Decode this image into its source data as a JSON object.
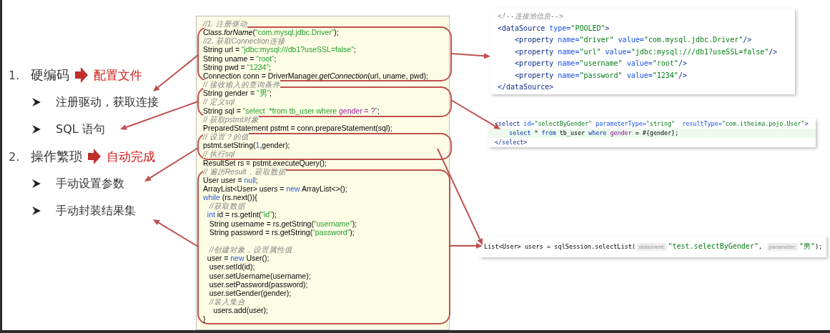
{
  "outline": [
    {
      "number": "1.",
      "text": "硬编码",
      "result": "配置文件",
      "children": [
        {
          "text": "注册驱动，获取连接"
        },
        {
          "text": "SQL 语句"
        }
      ]
    },
    {
      "number": "2.",
      "text": "操作繁琐",
      "result": "自动完成",
      "children": [
        {
          "text": "手动设置参数"
        },
        {
          "text": "手动封装结果集"
        }
      ]
    }
  ],
  "java_code": {
    "lines": [
      {
        "segments": [
          {
            "text": "//1. 注册驱动",
            "kind": "comment"
          }
        ]
      },
      {
        "segments": [
          {
            "text": "Class.",
            "kind": "plain"
          },
          {
            "text": "forName",
            "kind": "method"
          },
          {
            "text": "(",
            "kind": "plain"
          },
          {
            "text": "“com.mysql.jdbc.Driver”",
            "kind": "string"
          },
          {
            "text": ");",
            "kind": "plain"
          }
        ]
      },
      {
        "segments": [
          {
            "text": "//2. 获取Connection连接",
            "kind": "comment"
          }
        ]
      },
      {
        "segments": [
          {
            "text": "String url = ",
            "kind": "plain"
          },
          {
            "text": "“jdbc:mysql:///db1?useSSL=false”",
            "kind": "string"
          },
          {
            "text": ";",
            "kind": "plain"
          }
        ]
      },
      {
        "segments": [
          {
            "text": "String uname = ",
            "kind": "plain"
          },
          {
            "text": "“root”",
            "kind": "string"
          },
          {
            "text": ";",
            "kind": "plain"
          }
        ]
      },
      {
        "segments": [
          {
            "text": "String pwd = ",
            "kind": "plain"
          },
          {
            "text": "“1234”",
            "kind": "string"
          },
          {
            "text": ";",
            "kind": "plain"
          }
        ]
      },
      {
        "segments": [
          {
            "text": "Connection conn = DriverManager.",
            "kind": "plain"
          },
          {
            "text": "getConnection",
            "kind": "method"
          },
          {
            "text": "(url, uname, pwd);",
            "kind": "plain"
          }
        ]
      },
      {
        "segments": [
          {
            "text": "// 接收输入的查询条件",
            "kind": "comment"
          }
        ]
      },
      {
        "segments": [
          {
            "text": "String gender = ",
            "kind": "plain"
          },
          {
            "text": "“男”",
            "kind": "string"
          },
          {
            "text": ";",
            "kind": "plain"
          }
        ]
      },
      {
        "segments": [
          {
            "text": "// 定义sql",
            "kind": "comment"
          }
        ]
      },
      {
        "segments": [
          {
            "text": "String sql = ",
            "kind": "plain"
          },
          {
            "text": "“select  *from tb_user where ",
            "kind": "string"
          },
          {
            "text": "gender = ?",
            "kind": "field"
          },
          {
            "text": "”",
            "kind": "string"
          },
          {
            "text": ";",
            "kind": "plain"
          }
        ]
      },
      {
        "segments": [
          {
            "text": "// 获取pstmt对象",
            "kind": "comment"
          }
        ]
      },
      {
        "segments": [
          {
            "text": "PreparedStatement pstmt = conn.prepareStatement(sql);",
            "kind": "plain"
          }
        ]
      },
      {
        "segments": [
          {
            "text": "// 设置？的值",
            "kind": "comment"
          }
        ]
      },
      {
        "segments": [
          {
            "text": "pstmt.setString(",
            "kind": "plain"
          },
          {
            "text": "1",
            "kind": "number"
          },
          {
            "text": ",gender);",
            "kind": "plain"
          }
        ]
      },
      {
        "segments": [
          {
            "text": "// 执行sql",
            "kind": "comment"
          }
        ]
      },
      {
        "segments": [
          {
            "text": "ResultSet rs = pstmt.executeQuery();",
            "kind": "plain"
          }
        ]
      },
      {
        "segments": [
          {
            "text": "// 遍历Result，获取数据",
            "kind": "comment"
          }
        ]
      },
      {
        "segments": [
          {
            "text": "User user = ",
            "kind": "plain"
          },
          {
            "text": "null",
            "kind": "keyword"
          },
          {
            "text": ";",
            "kind": "plain"
          }
        ]
      },
      {
        "segments": [
          {
            "text": "ArrayList<User> users = ",
            "kind": "plain"
          },
          {
            "text": "new",
            "kind": "keyword"
          },
          {
            "text": " ArrayList<>();",
            "kind": "plain"
          }
        ]
      },
      {
        "segments": [
          {
            "text": "while",
            "kind": "keyword"
          },
          {
            "text": " (rs.next()){",
            "kind": "plain"
          }
        ]
      },
      {
        "segments": [
          {
            "text": "   //获取数据",
            "kind": "comment"
          }
        ]
      },
      {
        "segments": [
          {
            "text": "  int",
            "kind": "keyword"
          },
          {
            "text": " id = rs.getInt(",
            "kind": "plain"
          },
          {
            "text": "“id”",
            "kind": "string"
          },
          {
            "text": ");",
            "kind": "plain"
          }
        ]
      },
      {
        "segments": [
          {
            "text": "   String username = rs.getString(",
            "kind": "plain"
          },
          {
            "text": "“username”",
            "kind": "string"
          },
          {
            "text": ");",
            "kind": "plain"
          }
        ]
      },
      {
        "segments": [
          {
            "text": "   String password = rs.getString(",
            "kind": "plain"
          },
          {
            "text": "“password”",
            "kind": "string"
          },
          {
            "text": ");",
            "kind": "plain"
          }
        ]
      },
      {
        "kind": "blank"
      },
      {
        "segments": [
          {
            "text": "   //创建对象，设置属性值",
            "kind": "comment"
          }
        ]
      },
      {
        "segments": [
          {
            "text": "  user = ",
            "kind": "plain"
          },
          {
            "text": "new",
            "kind": "keyword"
          },
          {
            "text": " User();",
            "kind": "plain"
          }
        ]
      },
      {
        "segments": [
          {
            "text": "   user.setId(id);",
            "kind": "plain"
          }
        ]
      },
      {
        "segments": [
          {
            "text": "   user.setUsername(username);",
            "kind": "plain"
          }
        ]
      },
      {
        "segments": [
          {
            "text": "   user.setPassword(password);",
            "kind": "plain"
          }
        ]
      },
      {
        "segments": [
          {
            "text": "   user.setGender(gender);",
            "kind": "plain"
          }
        ]
      },
      {
        "segments": [
          {
            "text": "   //装入集合",
            "kind": "comment"
          }
        ]
      },
      {
        "segments": [
          {
            "text": "     users.add(user);",
            "kind": "plain"
          }
        ]
      },
      {
        "segments": [
          {
            "text": "}",
            "kind": "plain"
          }
        ]
      }
    ]
  },
  "xml_config": {
    "lines": [
      {
        "segments": [
          {
            "text": "<!--连接池信息-->",
            "kind": "comment"
          }
        ]
      },
      {
        "segments": [
          {
            "text": "<dataSource ",
            "kind": "tag"
          },
          {
            "text": "type=",
            "kind": "attr"
          },
          {
            "text": "\"POOLED\"",
            "kind": "value"
          },
          {
            "text": ">",
            "kind": "tag"
          }
        ]
      },
      {
        "segments": [
          {
            "text": "    <property ",
            "kind": "tag"
          },
          {
            "text": "name=",
            "kind": "attr"
          },
          {
            "text": "\"driver\" ",
            "kind": "value"
          },
          {
            "text": "value=",
            "kind": "attr"
          },
          {
            "text": "\"com.mysql.jdbc.Driver\"",
            "kind": "value"
          },
          {
            "text": "/>",
            "kind": "tag"
          }
        ]
      },
      {
        "segments": [
          {
            "text": "    <property ",
            "kind": "tag"
          },
          {
            "text": "name=",
            "kind": "attr"
          },
          {
            "text": "\"url\" ",
            "kind": "value"
          },
          {
            "text": "value=",
            "kind": "attr"
          },
          {
            "text": "\"jdbc:mysql:///db1?useSSL=false\"",
            "kind": "value"
          },
          {
            "text": "/>",
            "kind": "tag"
          }
        ]
      },
      {
        "segments": [
          {
            "text": "    <property ",
            "kind": "tag"
          },
          {
            "text": "name=",
            "kind": "attr"
          },
          {
            "text": "\"username\" ",
            "kind": "value"
          },
          {
            "text": "value=",
            "kind": "attr"
          },
          {
            "text": "\"root\"",
            "kind": "value"
          },
          {
            "text": "/>",
            "kind": "tag"
          }
        ]
      },
      {
        "segments": [
          {
            "text": "    <property ",
            "kind": "tag"
          },
          {
            "text": "name=",
            "kind": "attr"
          },
          {
            "text": "\"password\" ",
            "kind": "value"
          },
          {
            "text": "value=",
            "kind": "attr"
          },
          {
            "text": "\"1234\"",
            "kind": "value"
          },
          {
            "text": "/>",
            "kind": "tag"
          }
        ]
      },
      {
        "segments": [
          {
            "text": "</dataSource>",
            "kind": "tag"
          }
        ]
      }
    ]
  },
  "mapper_xml": {
    "lines": [
      {
        "highlighted": false,
        "segments": [
          {
            "text": "<select ",
            "kind": "tag"
          },
          {
            "text": "id=",
            "kind": "attr"
          },
          {
            "text": "\"selectByGender\" ",
            "kind": "value"
          },
          {
            "text": "parameterType=",
            "kind": "attr"
          },
          {
            "text": "\"string\"  ",
            "kind": "value"
          },
          {
            "text": "resultType=",
            "kind": "attr"
          },
          {
            "text": "\"com.itheima.pojo.User\"",
            "kind": "value"
          },
          {
            "text": ">",
            "kind": "tag"
          }
        ]
      },
      {
        "highlighted": true,
        "segments": [
          {
            "text": "    select",
            "kind": "keyword"
          },
          {
            "text": " * ",
            "kind": "plain"
          },
          {
            "text": "from",
            "kind": "keyword"
          },
          {
            "text": " tb_user ",
            "kind": "plain"
          },
          {
            "text": "where ",
            "kind": "keyword"
          },
          {
            "text": "gender",
            "kind": "field"
          },
          {
            "text": " = #{gender};",
            "kind": "plain"
          }
        ]
      },
      {
        "highlighted": false,
        "segments": [
          {
            "text": "</select>",
            "kind": "tag"
          }
        ]
      }
    ]
  },
  "java_call": {
    "lines": [
      {
        "segments": [
          {
            "text": "List<User> users = sqlSession.selectList(",
            "kind": "plain"
          },
          {
            "text": "statement:",
            "kind": "hint"
          },
          {
            "text": "\"test.selectByGender\"",
            "kind": "value"
          },
          {
            "text": ", ",
            "kind": "plain"
          },
          {
            "text": "parameter:",
            "kind": "hint"
          },
          {
            "text": "\"男\"",
            "kind": "value"
          },
          {
            "text": ");",
            "kind": "plain"
          }
        ]
      }
    ]
  }
}
